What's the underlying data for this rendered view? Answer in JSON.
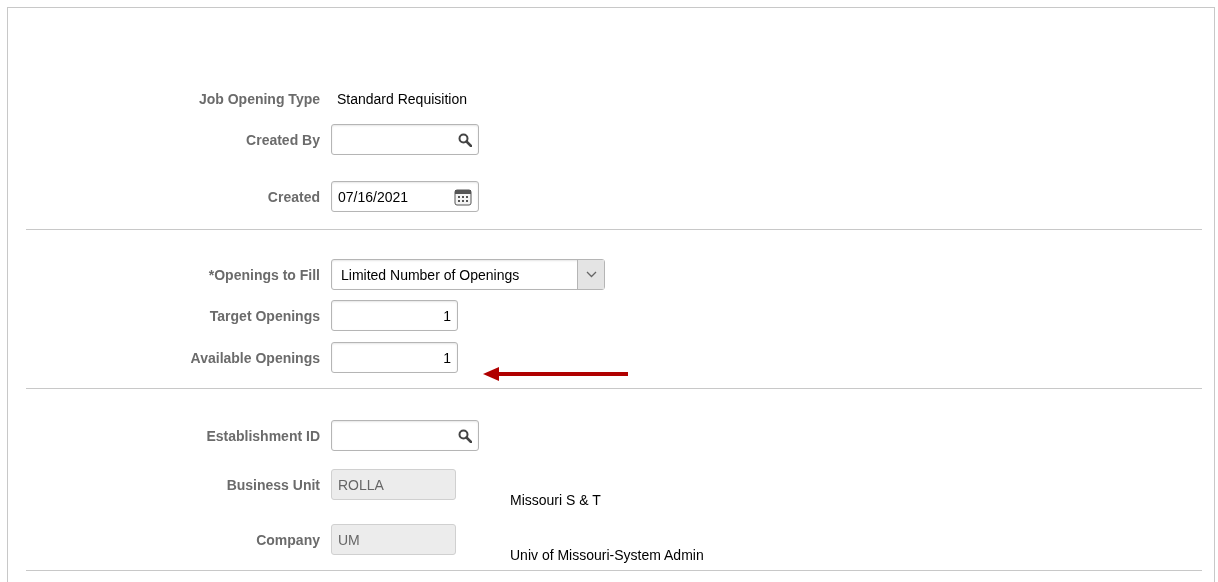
{
  "sections": [
    {
      "fields": [
        {
          "label": "Job Opening Type",
          "kind": "text",
          "value": "Standard Requisition"
        },
        {
          "label": "Created By",
          "kind": "lookup"
        },
        {
          "label": "Created",
          "kind": "date",
          "value": "07/16/2021"
        }
      ]
    },
    {
      "fields": [
        {
          "label": "*Openings to Fill",
          "kind": "select",
          "value": "Limited Number of Openings"
        },
        {
          "label": "Target Openings",
          "kind": "number",
          "value": "1"
        },
        {
          "label": "Available Openings",
          "kind": "number",
          "value": "1",
          "pointer": true
        }
      ]
    },
    {
      "fields": [
        {
          "label": "Establishment ID",
          "kind": "lookup"
        },
        {
          "label": "Business Unit",
          "kind": "readonly",
          "value": "ROLLA",
          "description": "Missouri S & T"
        },
        {
          "label": "Company",
          "kind": "readonly",
          "value": "UM",
          "description": "Univ of Missouri-System Admin"
        }
      ]
    }
  ]
}
